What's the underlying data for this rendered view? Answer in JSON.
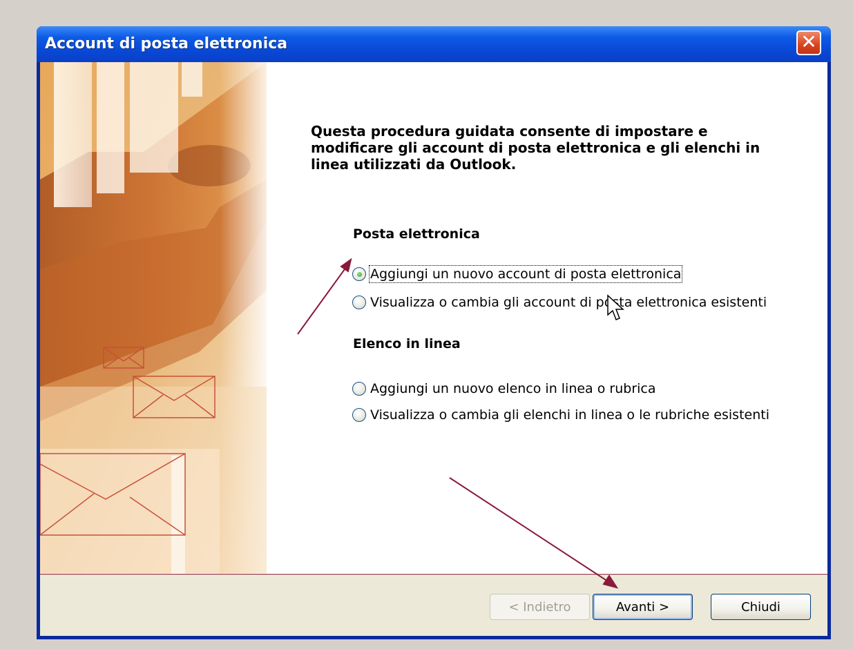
{
  "window": {
    "title": "Account di posta elettronica",
    "close_icon": "close-icon"
  },
  "intro_text": "Questa procedura guidata consente di impostare e modificare gli account di posta elettronica e gli elenchi in linea utilizzati da Outlook.",
  "sections": [
    {
      "heading": "Posta elettronica",
      "options": [
        {
          "label": "Aggiungi un nuovo account di posta elettronica",
          "checked": true,
          "focused": true
        },
        {
          "label": "Visualizza o cambia gli account di posta elettronica esistenti",
          "checked": false
        }
      ]
    },
    {
      "heading": "Elenco in linea",
      "options": [
        {
          "label": "Aggiungi un nuovo elenco in linea o rubrica",
          "checked": false
        },
        {
          "label": "Visualizza o cambia gli elenchi in linea o le rubriche esistenti",
          "checked": false
        }
      ]
    }
  ],
  "buttons": {
    "back": "< Indietro",
    "next": "Avanti >",
    "close": "Chiudi"
  },
  "colors": {
    "titlebar": "#0848d6",
    "annotation_arrow": "#8b1a3a",
    "art_orange": "#d98a38"
  }
}
